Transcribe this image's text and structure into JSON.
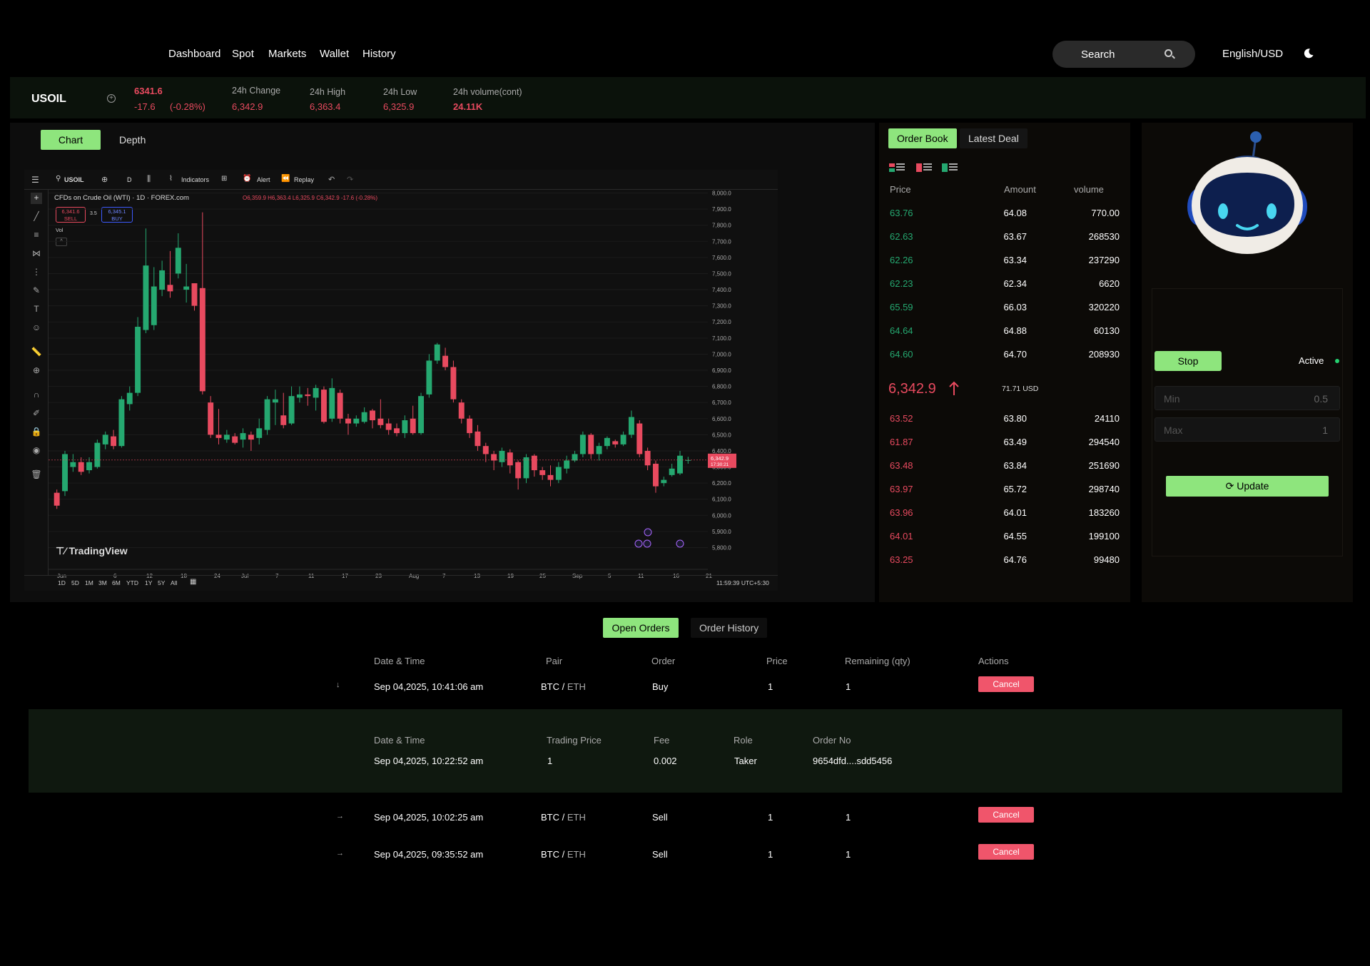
{
  "nav": {
    "items": [
      "Dashboard",
      "Spot",
      "Markets",
      "Wallet",
      "History"
    ],
    "search_placeholder": "Search",
    "language": "English/USD"
  },
  "ticker": {
    "symbol": "USOIL",
    "last_price": "6341.6",
    "change_abs": "-17.6",
    "change_pct": "(-0.28%)",
    "change_label": "24h Change",
    "change_value": "6,342.9",
    "high_label": "24h High",
    "high_value": "6,363.4",
    "low_label": "24h Low",
    "low_value": "6,325.9",
    "volume_label": "24h volume(cont)",
    "volume_value": "24.11K"
  },
  "chart_tabs": {
    "chart": "Chart",
    "depth": "Depth"
  },
  "tv": {
    "symbol": "USOIL",
    "interval": "D",
    "indicators": "Indicators",
    "alert": "Alert",
    "replay": "Replay",
    "title": "CFDs on Crude Oil (WTI) · 1D · FOREX.com",
    "ohlc": "O6,359.9 H6,363.4 L6,325.9 C6,342.9 -17.6 (-0.28%)",
    "sell_price": "6,341.6",
    "sell": "SELL",
    "spread": "3.5",
    "buy_price": "6,345.1",
    "buy": "BUY",
    "vol": "Vol",
    "brand": "TradingView",
    "ranges": [
      "1D",
      "5D",
      "1M",
      "3M",
      "6M",
      "YTD",
      "1Y",
      "5Y",
      "All"
    ],
    "time": "11:59:39 UTC+5:30",
    "last_label": "6,342.9",
    "last_timer": "17:30:21"
  },
  "chart_data": {
    "type": "candlestick",
    "title": "CFDs on Crude Oil (WTI) · 1D · FOREX.com",
    "y_ticks": [
      8000,
      7900,
      7800,
      7700,
      7600,
      7500,
      7400,
      7300,
      7200,
      7100,
      7000,
      6900,
      6800,
      6700,
      6600,
      6500,
      6400,
      6300,
      6200,
      6100,
      6000,
      5900,
      5800
    ],
    "ylim": [
      5780,
      8020
    ],
    "x_ticks": [
      "Jun",
      "6",
      "12",
      "18",
      "24",
      "Jul",
      "7",
      "11",
      "17",
      "23",
      "Aug",
      "7",
      "13",
      "19",
      "25",
      "Sep",
      "5",
      "11",
      "16",
      "21"
    ],
    "candles": [
      [
        6140,
        6060,
        6040,
        6160
      ],
      [
        6150,
        6380,
        6120,
        6400
      ],
      [
        6300,
        6330,
        6270,
        6380
      ],
      [
        6330,
        6270,
        6250,
        6360
      ],
      [
        6280,
        6330,
        6260,
        6360
      ],
      [
        6300,
        6450,
        6290,
        6470
      ],
      [
        6440,
        6500,
        6410,
        6520
      ],
      [
        6490,
        6430,
        6410,
        6530
      ],
      [
        6430,
        6720,
        6420,
        6740
      ],
      [
        6690,
        6760,
        6650,
        6800
      ],
      [
        6760,
        7170,
        6740,
        7230
      ],
      [
        7150,
        7550,
        7130,
        7780
      ],
      [
        7180,
        7420,
        7150,
        7540
      ],
      [
        7400,
        7520,
        7360,
        7580
      ],
      [
        7430,
        7390,
        7350,
        7640
      ],
      [
        7500,
        7660,
        7470,
        7750
      ],
      [
        7400,
        7420,
        7320,
        7560
      ],
      [
        7440,
        7300,
        7270,
        7440
      ],
      [
        7410,
        6770,
        6750,
        7880
      ],
      [
        6700,
        6500,
        6480,
        6740
      ],
      [
        6500,
        6480,
        6440,
        6660
      ],
      [
        6470,
        6500,
        6450,
        6530
      ],
      [
        6490,
        6450,
        6440,
        6510
      ],
      [
        6470,
        6510,
        6420,
        6540
      ],
      [
        6500,
        6470,
        6400,
        6520
      ],
      [
        6480,
        6540,
        6440,
        6600
      ],
      [
        6530,
        6720,
        6500,
        6740
      ],
      [
        6700,
        6720,
        6560,
        6780
      ],
      [
        6620,
        6560,
        6540,
        6760
      ],
      [
        6570,
        6740,
        6560,
        6800
      ],
      [
        6730,
        6750,
        6700,
        6800
      ],
      [
        6750,
        6740,
        6680,
        6790
      ],
      [
        6730,
        6790,
        6650,
        6810
      ],
      [
        6780,
        6580,
        6570,
        6800
      ],
      [
        6600,
        6790,
        6580,
        6850
      ],
      [
        6760,
        6600,
        6570,
        6780
      ],
      [
        6600,
        6570,
        6500,
        6630
      ],
      [
        6570,
        6600,
        6550,
        6620
      ],
      [
        6580,
        6640,
        6570,
        6670
      ],
      [
        6650,
        6590,
        6540,
        6660
      ],
      [
        6600,
        6560,
        6540,
        6720
      ],
      [
        6570,
        6530,
        6500,
        6600
      ],
      [
        6540,
        6510,
        6490,
        6570
      ],
      [
        6510,
        6590,
        6480,
        6620
      ],
      [
        6600,
        6510,
        6500,
        6680
      ],
      [
        6510,
        6740,
        6500,
        6760
      ],
      [
        6750,
        6960,
        6730,
        7000
      ],
      [
        6960,
        7060,
        6940,
        7070
      ],
      [
        6990,
        6920,
        6900,
        7040
      ],
      [
        6920,
        6720,
        6700,
        6960
      ],
      [
        6700,
        6600,
        6570,
        6720
      ],
      [
        6600,
        6510,
        6480,
        6620
      ],
      [
        6520,
        6430,
        6400,
        6560
      ],
      [
        6430,
        6380,
        6330,
        6450
      ],
      [
        6380,
        6340,
        6280,
        6400
      ],
      [
        6330,
        6400,
        6300,
        6420
      ],
      [
        6390,
        6310,
        6260,
        6410
      ],
      [
        6330,
        6230,
        6160,
        6340
      ],
      [
        6230,
        6360,
        6200,
        6380
      ],
      [
        6370,
        6280,
        6240,
        6380
      ],
      [
        6280,
        6250,
        6220,
        6300
      ],
      [
        6250,
        6220,
        6180,
        6310
      ],
      [
        6220,
        6300,
        6200,
        6330
      ],
      [
        6290,
        6340,
        6260,
        6370
      ],
      [
        6340,
        6380,
        6330,
        6400
      ],
      [
        6380,
        6500,
        6360,
        6520
      ],
      [
        6500,
        6380,
        6350,
        6510
      ],
      [
        6380,
        6430,
        6340,
        6450
      ],
      [
        6430,
        6480,
        6410,
        6490
      ],
      [
        6460,
        6440,
        6420,
        6470
      ],
      [
        6440,
        6500,
        6430,
        6520
      ],
      [
        6500,
        6610,
        6480,
        6650
      ],
      [
        6570,
        6380,
        6360,
        6590
      ],
      [
        6400,
        6310,
        6280,
        6420
      ],
      [
        6320,
        6180,
        6140,
        6340
      ],
      [
        6200,
        6220,
        6180,
        6240
      ],
      [
        6250,
        6290,
        6240,
        6320
      ],
      [
        6260,
        6370,
        6250,
        6400
      ],
      [
        6340,
        6343,
        6320,
        6363
      ]
    ],
    "last_price": 6342.9
  },
  "order_book": {
    "tabs": [
      "Order Book",
      "Latest Deal"
    ],
    "headers": {
      "price": "Price",
      "amount": "Amount",
      "volume": "volume"
    },
    "bids": [
      [
        "63.76",
        "64.08",
        "770.00"
      ],
      [
        "62.63",
        "63.67",
        "268530"
      ],
      [
        "62.26",
        "63.34",
        "237290"
      ],
      [
        "62.23",
        "62.34",
        "6620"
      ],
      [
        "65.59",
        "66.03",
        "320220"
      ],
      [
        "64.64",
        "64.88",
        "60130"
      ],
      [
        "64.60",
        "64.70",
        "208930"
      ]
    ],
    "mid_price": "6,342.9",
    "mid_usd": "71.71 USD",
    "asks": [
      [
        "63.52",
        "63.80",
        "24110"
      ],
      [
        "61.87",
        "63.49",
        "294540"
      ],
      [
        "63.48",
        "63.84",
        "251690"
      ],
      [
        "63.97",
        "65.72",
        "298740"
      ],
      [
        "63.96",
        "64.01",
        "183260"
      ],
      [
        "64.01",
        "64.55",
        "199100"
      ],
      [
        "63.25",
        "64.76",
        "99480"
      ]
    ],
    "colors": {
      "bid": "#25a870",
      "ask": "#e84a5f"
    }
  },
  "bot": {
    "stop": "Stop",
    "status": "Active",
    "min_placeholder": "Min",
    "min_value": "0.5",
    "max_placeholder": "Max",
    "max_value": "1",
    "update": "Update"
  },
  "orders": {
    "tabs": [
      "Open Orders",
      "Order History"
    ],
    "headers": [
      "Date & Time",
      "Pair",
      "Order",
      "Price",
      "Remaining (qty)",
      "Actions"
    ],
    "rows": [
      {
        "date": "Sep 04,2025, 10:41:06 am",
        "base": "BTC",
        "quote": "ETH",
        "order": "Buy",
        "price": "1",
        "remaining": "1",
        "action": "Cancel"
      },
      {
        "date": "Sep 04,2025, 10:02:25 am",
        "base": "BTC",
        "quote": "ETH",
        "order": "Sell",
        "price": "1",
        "remaining": "1",
        "action": "Cancel"
      },
      {
        "date": "Sep 04,2025, 09:35:52 am",
        "base": "BTC",
        "quote": "ETH",
        "order": "Sell",
        "price": "1",
        "remaining": "1",
        "action": "Cancel"
      }
    ],
    "detail_headers": [
      "Date & Time",
      "Trading Price",
      "Fee",
      "Role",
      "Order No"
    ],
    "detail": {
      "date": "Sep 04,2025, 10:22:52 am",
      "price": "1",
      "fee": "0.002",
      "role": "Taker",
      "order_no": "9654dfd....sdd5456"
    }
  },
  "colors": {
    "accent": "#8ee57d",
    "up": "#25a870",
    "down": "#e84a5f",
    "bg": "#000000"
  }
}
